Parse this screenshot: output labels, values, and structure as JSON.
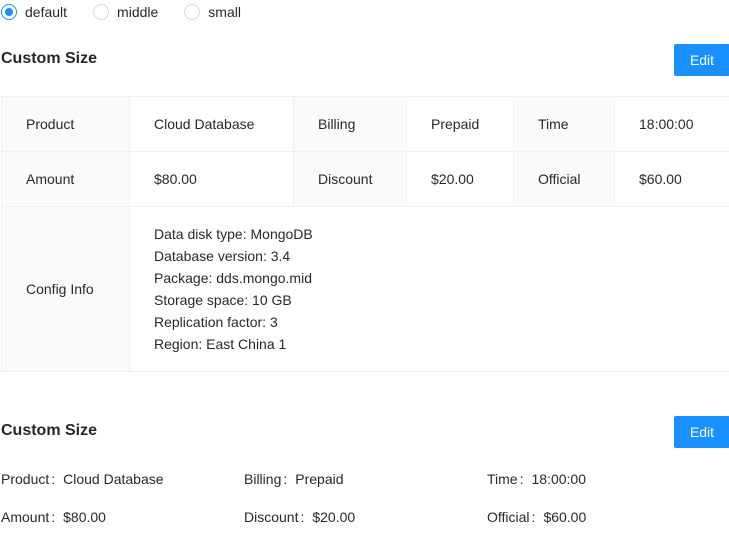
{
  "size_options": [
    {
      "label": "default",
      "checked": true
    },
    {
      "label": "middle",
      "checked": false
    },
    {
      "label": "small",
      "checked": false
    }
  ],
  "bordered": {
    "title": "Custom Size",
    "edit_label": "Edit",
    "rows": [
      [
        {
          "label": "Product",
          "value": "Cloud Database"
        },
        {
          "label": "Billing",
          "value": "Prepaid"
        },
        {
          "label": "Time",
          "value": "18:00:00"
        }
      ],
      [
        {
          "label": "Amount",
          "value": "$80.00"
        },
        {
          "label": "Discount",
          "value": "$20.00"
        },
        {
          "label": "Official",
          "value": "$60.00"
        }
      ]
    ],
    "config": {
      "label": "Config Info",
      "lines": [
        "Data disk type: MongoDB",
        "Database version: 3.4",
        "Package: dds.mongo.mid",
        "Storage space: 10 GB",
        "Replication factor: 3",
        "Region: East China 1"
      ]
    }
  },
  "plain": {
    "title": "Custom Size",
    "edit_label": "Edit",
    "rows": [
      [
        {
          "label": "Product",
          "value": "Cloud Database"
        },
        {
          "label": "Billing",
          "value": "Prepaid"
        },
        {
          "label": "Time",
          "value": "18:00:00"
        }
      ],
      [
        {
          "label": "Amount",
          "value": "$80.00"
        },
        {
          "label": "Discount",
          "value": "$20.00"
        },
        {
          "label": "Official",
          "value": "$60.00"
        }
      ]
    ]
  },
  "colors": {
    "primary": "#1890ff",
    "label_bg": "#fafafa",
    "border": "#f0f0f0"
  }
}
